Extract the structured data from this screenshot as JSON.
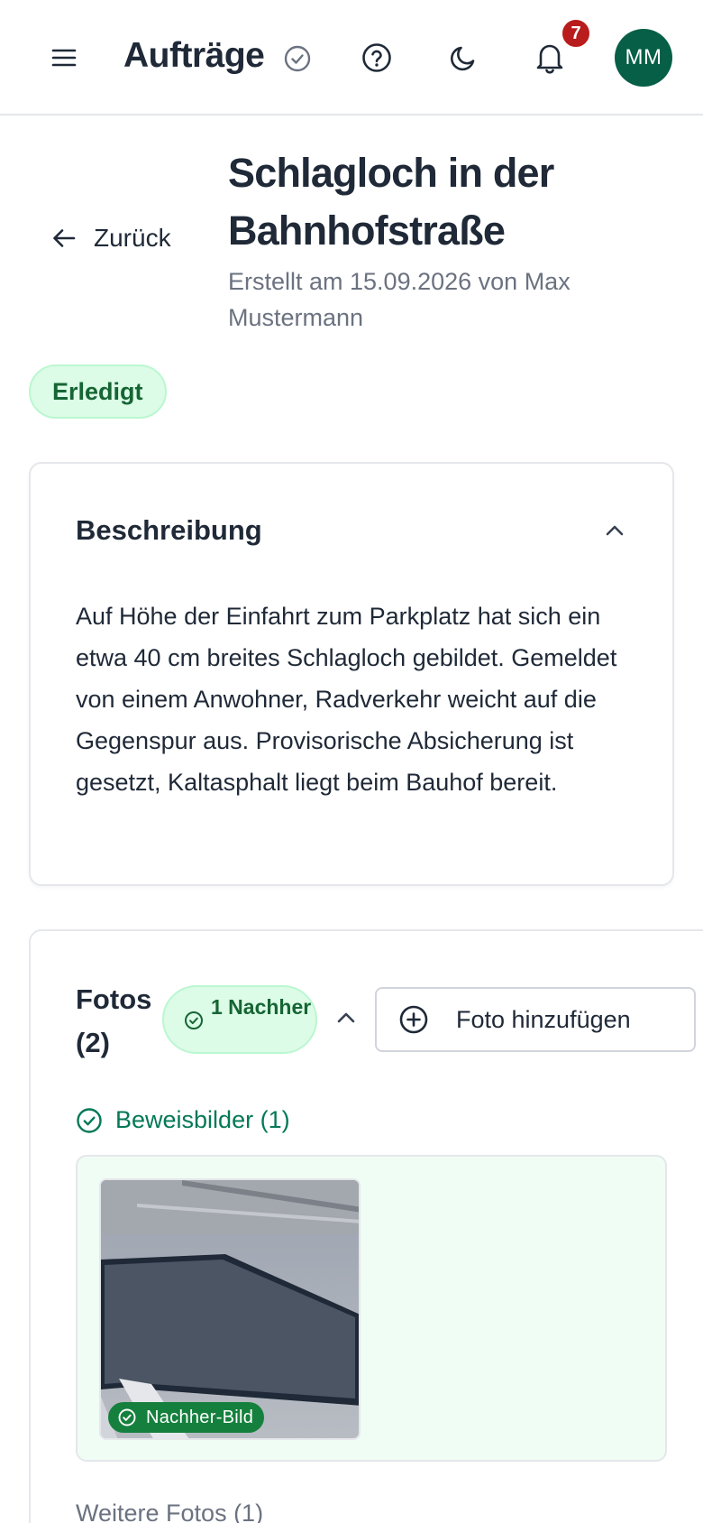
{
  "header": {
    "title": "Aufträge",
    "notification_count": "7",
    "avatar_initials": "MM"
  },
  "page": {
    "back_label": "Zurück",
    "title": "Schlagloch in der Bahnhofstraße",
    "created": "Erstellt am 15.09.2026 von Max Mustermann",
    "status": "Erledigt"
  },
  "description": {
    "title": "Beschreibung",
    "text": "Auf Höhe der Einfahrt zum Parkplatz hat sich ein etwa 40 cm breites Schlagloch gebildet. Gemeldet von einem Anwohner, Radverkehr weicht auf die Gegenspur aus. Provisorische Absicherung ist gesetzt, Kaltasphalt liegt beim Bauhof bereit."
  },
  "photos": {
    "title": "Fotos (2)",
    "nachher_chip": "1 Nachher",
    "add_label": "Foto hinzufügen",
    "evidence_heading": "Beweisbilder (1)",
    "evidence_tag": "Nachher-Bild",
    "more_heading": "Weitere Fotos (1)"
  },
  "colors": {
    "accent_green": "#047857",
    "status_bg": "#dcfce7",
    "badge_red": "#b91c1c",
    "avatar_bg": "#065f46"
  },
  "icons": [
    "menu-icon",
    "check-circle-icon",
    "help-icon",
    "moon-icon",
    "bell-icon",
    "arrow-left-icon",
    "chevron-up-icon",
    "plus-circle-icon"
  ]
}
